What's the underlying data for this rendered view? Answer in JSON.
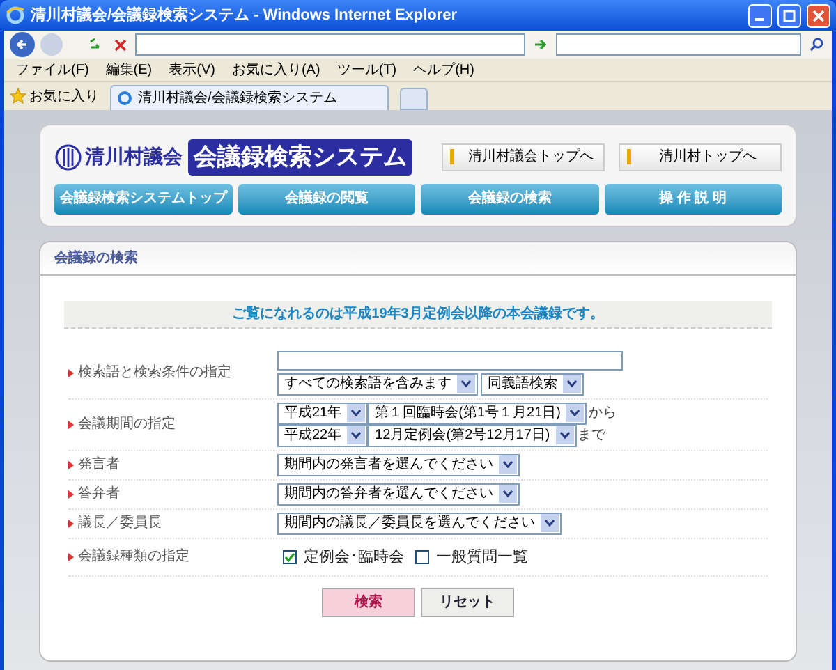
{
  "window": {
    "title": "清川村議会/会議録検索システム - Windows Internet Explorer"
  },
  "menu": [
    "ファイル(F)",
    "編集(E)",
    "表示(V)",
    "お気に入り(A)",
    "ツール(T)",
    "ヘルプ(H)"
  ],
  "favorites": {
    "label": "お気に入り"
  },
  "tabs": [
    {
      "label": "清川村議会/会議録検索システム",
      "selected": true
    }
  ],
  "header": {
    "logo_text": "清川村議会",
    "system_title": "会議録検索システム",
    "links": [
      "清川村議会トップへ",
      "清川村トップへ"
    ],
    "nav": [
      "会議録検索システムトップ",
      "会議録の閲覧",
      "会議録の検索",
      "操 作 説 明"
    ]
  },
  "panel": {
    "title": "会議録の検索",
    "notice": "ご覧になれるのは平成19年3月定例会以降の本会議録です。",
    "rows": [
      {
        "kind": "keyword",
        "label": "検索語と検索条件の指定",
        "selects": [
          "すべての検索語を含みます",
          "同義語検索"
        ]
      },
      {
        "kind": "period",
        "label": "会議期間の指定",
        "lines": [
          {
            "year": "平成21年",
            "session": "第１回臨時会(第1号１月21日)",
            "suffix": "から"
          },
          {
            "year": "平成22年",
            "session": "12月定例会(第2号12月17日)",
            "suffix": "まで"
          }
        ]
      },
      {
        "kind": "select",
        "label": "発言者",
        "value": "期間内の発言者を選んでください"
      },
      {
        "kind": "select",
        "label": "答弁者",
        "value": "期間内の答弁者を選んでください"
      },
      {
        "kind": "select",
        "label": "議長／委員長",
        "value": "期間内の議長／委員長を選んでください"
      },
      {
        "kind": "checks",
        "label": "会議録種類の指定",
        "options": [
          {
            "label": "定例会･臨時会",
            "checked": true
          },
          {
            "label": "一般質問一覧",
            "checked": false
          }
        ]
      }
    ],
    "buttons": [
      {
        "kind": "primary",
        "label": "検索"
      },
      {
        "kind": "secondary",
        "label": "リセット"
      }
    ]
  }
}
